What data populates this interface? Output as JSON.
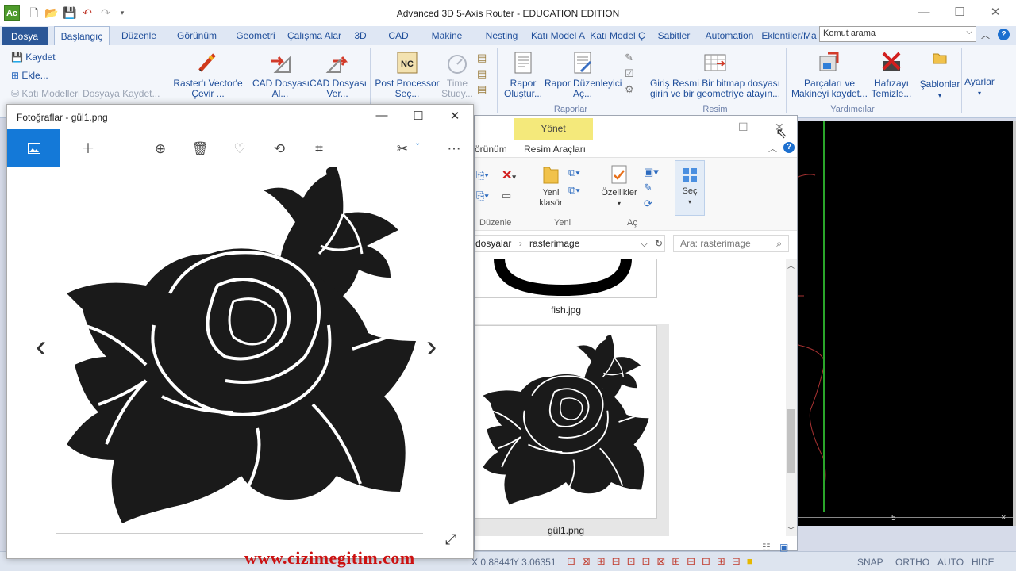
{
  "app": {
    "title": "Advanced 3D 5-Axis Router - EDUCATION EDITION",
    "logo": "Ac",
    "search_value": "Komut arama"
  },
  "tabs": [
    "Dosya",
    "Başlangıç",
    "Düzenle",
    "Görünüm",
    "Geometri",
    "Çalışma Alar",
    "3D",
    "CAD",
    "Makine",
    "Nesting",
    "Katı Model A",
    "Katı Model Ç",
    "Sabitler",
    "Automation",
    "Eklentiler/Ma"
  ],
  "ribbon": {
    "kaydet": "Kaydet",
    "ekle": "Ekle...",
    "kati_kaydet": "Katı Modelleri Dosyaya Kaydet...",
    "raster_a": "Raster'ı Vector'e",
    "raster_b": "Çevir ...",
    "cad_al_a": "CAD Dosyası",
    "cad_al_b": "Al...",
    "cad_ver_a": "CAD Dosyası",
    "cad_ver_b": "Ver...",
    "post_a": "Post Processor",
    "post_b": "Seç...",
    "time_a": "Time",
    "time_b": "Study...",
    "rapor_a": "Rapor",
    "rapor_b": "Oluştur...",
    "rapor_duz_a": "Rapor Düzenleyici",
    "rapor_duz_b": "Aç...",
    "raporlar_group": "Raporlar",
    "giris_a": "Giriş Resmi Bir bitmap dosyası",
    "giris_b": "girin ve bir geometriye atayın...",
    "resim_group": "Resim",
    "parca_a": "Parçaları ve",
    "parca_b": "Makineyi kaydet...",
    "hafiza_a": "Hafızayı",
    "hafiza_b": "Temizle...",
    "yardimcilar_group": "Yardımcılar",
    "sablonlar": "Şablonlar",
    "ayarlar": "Ayarlar"
  },
  "photos": {
    "title": "Fotoğraflar - gül1.png"
  },
  "explorer": {
    "yonet": "Yönet",
    "tab_gorunum": "örünüm",
    "tab_resim": "Resim Araçları",
    "yeni_klasor_a": "Yeni",
    "yeni_klasor_b": "klasör",
    "ozellikler": "Özellikler",
    "sec": "Seç",
    "grp_duzenle": "Düzenle",
    "grp_yeni": "Yeni",
    "grp_ac": "Aç",
    "addr_1": "dosyalar",
    "addr_2": "rasterimage",
    "search_placeholder": "Ara: rasterimage",
    "file1": "fish.jpg",
    "file2": "gül1.png"
  },
  "cad": {
    "ruler_label": "5"
  },
  "status": {
    "x": "X 0.88441",
    "y": "Y 3.06351",
    "snap": "SNAP",
    "ortho": "ORTHO",
    "auto": "AUTO",
    "hide": "HIDE"
  },
  "watermark": "www.cizimegitim.com",
  "colors": {
    "accent": "#2b5797",
    "ribbon_text": "#1f4e9a",
    "photos_accent": "#1479d8",
    "manage_tab": "#f4e97b",
    "watermark": "#cc1111"
  }
}
